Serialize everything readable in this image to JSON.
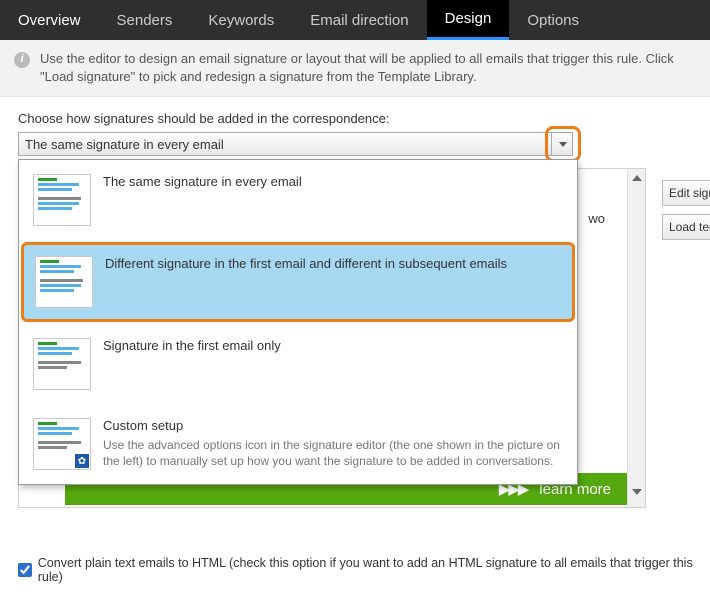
{
  "tabs": [
    "Overview",
    "Senders",
    "Keywords",
    "Email direction",
    "Design",
    "Options"
  ],
  "active_tab_index": 4,
  "info_text": "Use the editor to design an email signature or layout that will be applied to all emails that trigger this rule. Click \"Load signature\" to pick and redesign a signature from the Template Library.",
  "choose_label": "Choose how signatures should be added in the correspondence:",
  "select_value": "The same signature in every email",
  "options": {
    "o0": {
      "title": "The same signature in every email"
    },
    "o1": {
      "title": "Different signature in the first email and different in subsequent emails"
    },
    "o2": {
      "title": "Signature in the first email only"
    },
    "o3": {
      "title": "Custom setup",
      "desc": "Use the advanced options icon in the signature editor (the one shown in the picture on the left) to manually set up how you want the signature to be added in conversations."
    }
  },
  "highlighted_index": 1,
  "right_buttons": {
    "edit": "Edit signature",
    "load": "Load template"
  },
  "banner_text": "learn more",
  "peek_word": "wo",
  "checkbox": {
    "checked": true,
    "label": "Convert plain text emails to HTML (check this option if you want to add an HTML signature to all emails that trigger this rule)"
  }
}
